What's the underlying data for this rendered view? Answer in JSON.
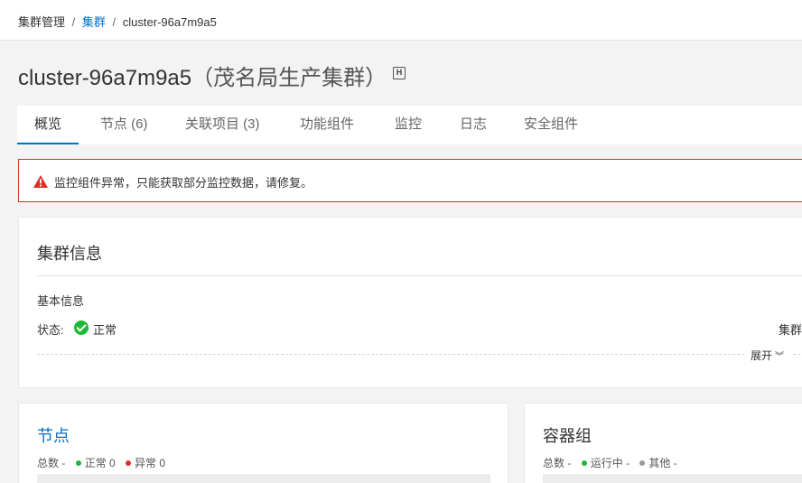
{
  "breadcrumb": {
    "root": "集群管理",
    "sep1": "/",
    "clusters": "集群",
    "sep2": "/",
    "current": "cluster-96a7m9a5"
  },
  "header": {
    "cluster_id": "cluster-96a7m9a5",
    "name_open": "（",
    "cluster_name": "茂名局生产集群",
    "name_close": "）",
    "badge_letter": "H"
  },
  "tabs": [
    {
      "label": "概览",
      "active": true
    },
    {
      "label": "节点 (6)"
    },
    {
      "label": "关联项目 (3)"
    },
    {
      "label": "功能组件"
    },
    {
      "label": "监控"
    },
    {
      "label": "日志"
    },
    {
      "label": "安全组件"
    }
  ],
  "alert": {
    "icon": "warning-icon",
    "text": "监控组件异常，只能获取部分监控数据，请修复。"
  },
  "cluster_info": {
    "title": "集群信息",
    "basic_info": "基本信息",
    "status_label": "状态:",
    "status_icon": "check-circle-icon",
    "status_value": "正常",
    "right_label": "集群",
    "expand": "展开",
    "expand_icon": "double-chevron-down-icon"
  },
  "nodes_card": {
    "title": "节点",
    "total_label": "总数 -",
    "normal_label": "正常 0",
    "abnormal_label": "异常 0"
  },
  "pods_card": {
    "title": "容器组",
    "total_label": "总数 -",
    "running_label": "运行中 -",
    "other_label": "其他 -"
  },
  "colors": {
    "accent": "#0070cc",
    "error": "#d93026",
    "success": "#1bb934",
    "other": "#999999"
  }
}
